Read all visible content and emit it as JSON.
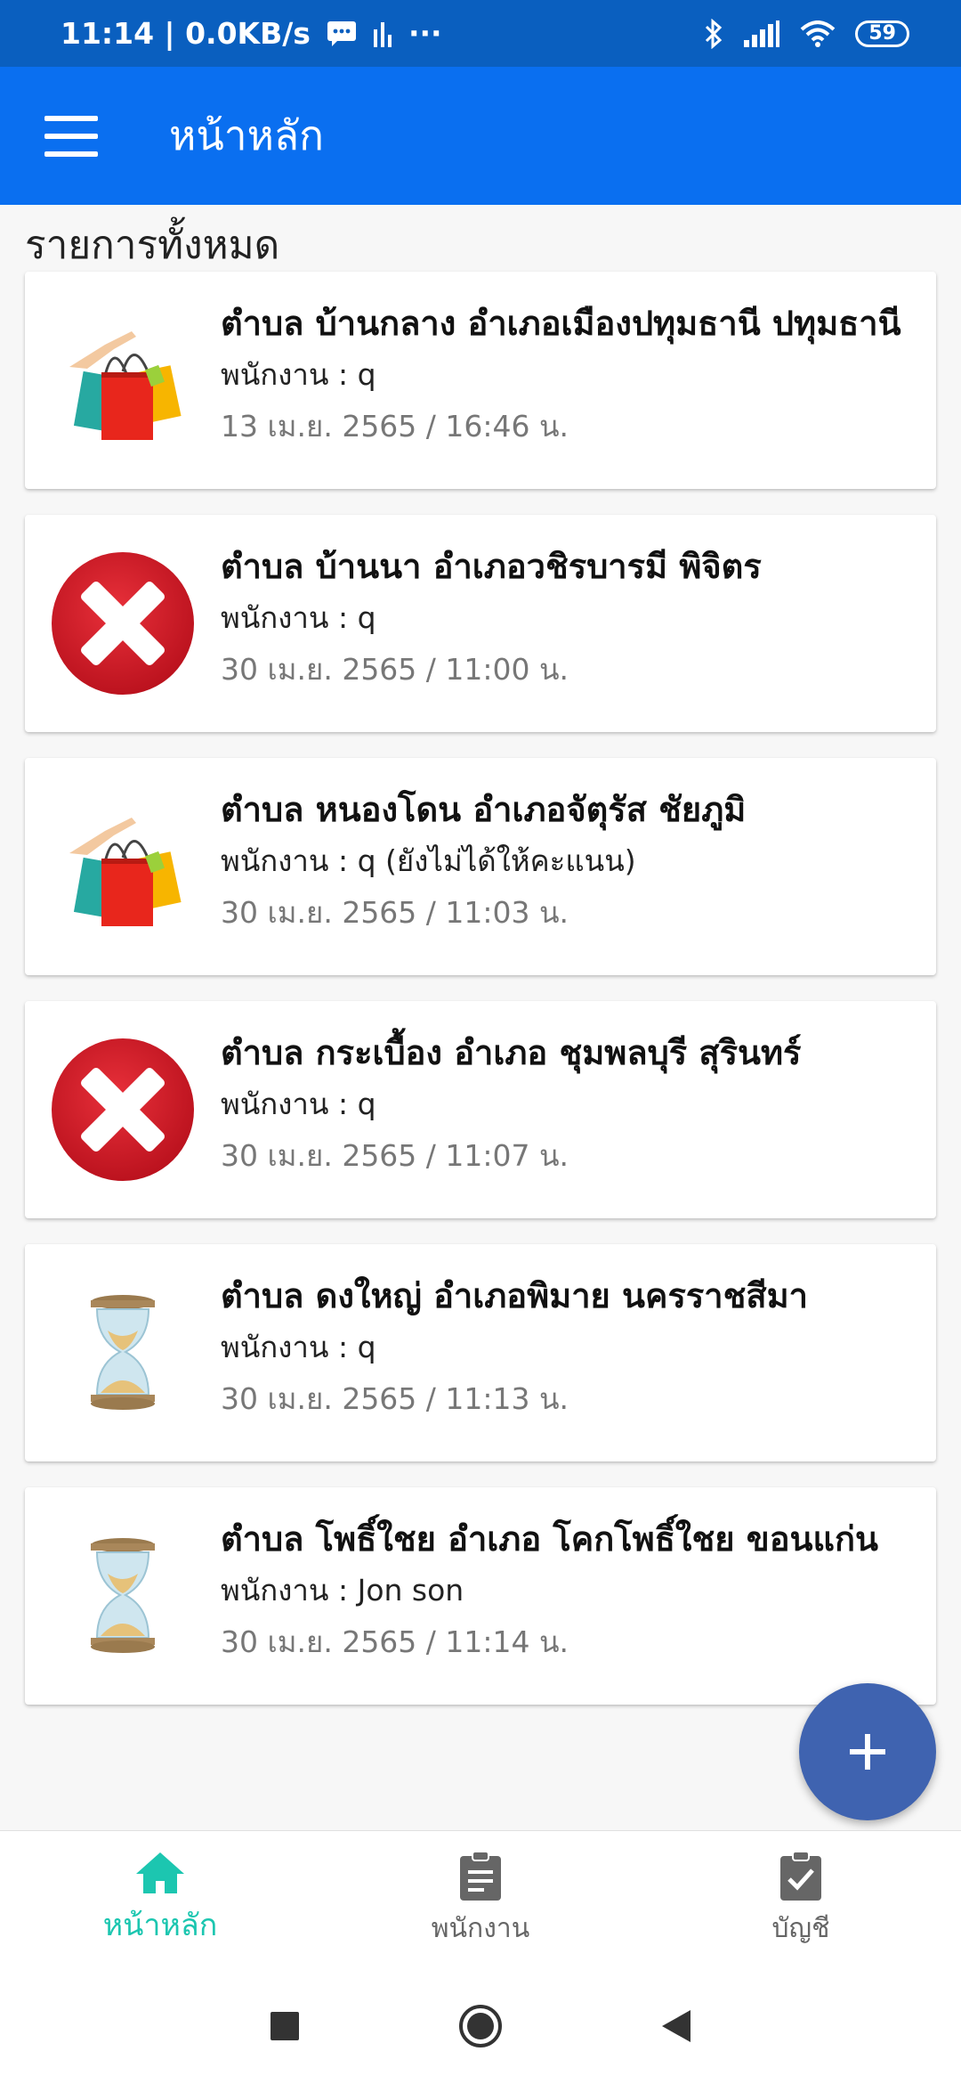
{
  "status_bar": {
    "time_speed": "11:14 | 0.0KB/s",
    "more": "···",
    "battery": "59"
  },
  "app_bar": {
    "title": "หน้าหลัก"
  },
  "section_title": "รายการทั้งหมด",
  "items": [
    {
      "icon": "shopping-bags-icon",
      "title": "ตำบล บ้านกลาง อำเภอเมืองปทุมธานี ปทุมธานี",
      "staff": "พนักงาน : q",
      "date": "13 เม.ย. 2565 / 16:46 น."
    },
    {
      "icon": "red-x-icon",
      "title": "ตำบล บ้านนา อำเภอวชิรบารมี พิจิตร",
      "staff": "พนักงาน : q",
      "date": "30 เม.ย. 2565 / 11:00 น."
    },
    {
      "icon": "shopping-bags-icon",
      "title": "ตำบล หนองโดน อำเภอจัตุรัส ชัยภูมิ",
      "staff": "พนักงาน : q (ยังไม่ได้ให้คะแนน)",
      "date": "30 เม.ย. 2565 / 11:03 น."
    },
    {
      "icon": "red-x-icon",
      "title": "ตำบล กระเบื้อง อำเภอ ชุมพลบุรี สุรินทร์",
      "staff": "พนักงาน : q",
      "date": "30 เม.ย. 2565 / 11:07 น."
    },
    {
      "icon": "hourglass-icon",
      "title": "ตำบล ดงใหญ่ อำเภอพิมาย นครราชสีมา",
      "staff": "พนักงาน : q",
      "date": "30 เม.ย. 2565 / 11:13 น."
    },
    {
      "icon": "hourglass-icon",
      "title": "ตำบล โพธิ์ใชย อำเภอ โคกโพธิ์ใชย ขอนแก่น",
      "staff": "พนักงาน : Jon son",
      "date": "30 เม.ย. 2565 / 11:14 น."
    }
  ],
  "bottom_nav": {
    "home": "หน้าหลัก",
    "staff": "พนักงาน",
    "account": "บัญชี"
  },
  "colors": {
    "status_bar": "#0a5fbf",
    "app_bar": "#0a6ff0",
    "fab": "#3f63b0",
    "nav_active": "#1cc6b0"
  }
}
